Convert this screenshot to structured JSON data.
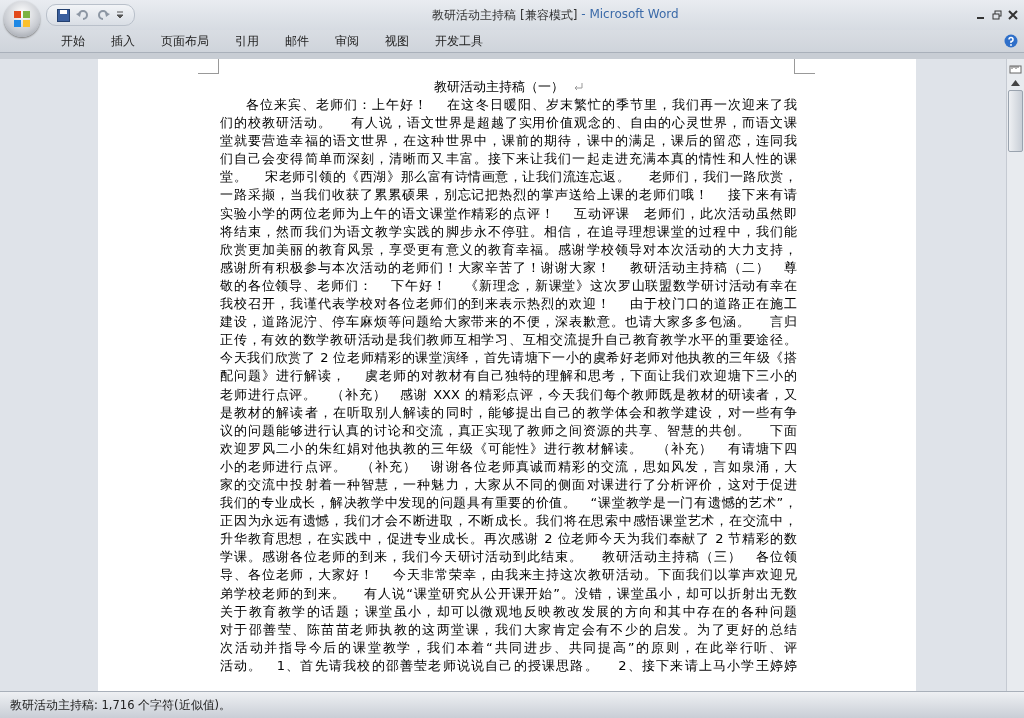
{
  "window": {
    "title": "教研活动主持稿 [兼容模式]",
    "app": " - Microsoft Word"
  },
  "ribbon_tabs": [
    "开始",
    "插入",
    "页面布局",
    "引用",
    "邮件",
    "审阅",
    "视图",
    "开发工具"
  ],
  "document": {
    "title": "教研活动主持稿（一）",
    "lines": [
      "各位来宾、老师们：上午好！　 在这冬日暖阳、岁末繁忙的季节里，我们再一次迎来了我",
      "们的校教研活动。　 有人说，语文世界是超越了实用价值观念的、自由的心灵世界，而语文课",
      "堂就要营造幸福的语文世界，在这种世界中，课前的期待，课中的满足，课后的留恋，连同我",
      "们自己会变得简单而深刻，清晰而又丰富。接下来让我们一起走进充满本真的情性和人性的课",
      "堂。　 宋老师引领的《西湖》那么富有诗情画意，让我们流连忘返。　 老师们，我们一路欣赏，",
      "一路采撷，当我们收获了累累硕果，别忘记把热烈的掌声送给上课的老师们哦！　 接下来有请",
      "实验小学的两位老师为上午的语文课堂作精彩的点评！　 互动评课　老师们，此次活动虽然即",
      "将结束，然而我们为语文教学实践的脚步永不停驻。相信，在追寻理想课堂的过程中，我们能",
      "欣赏更加美丽的教育风景，享受更有意义的教育幸福。感谢学校领导对本次活动的大力支持，",
      "感谢所有积极参与本次活动的老师们！大家辛苦了！谢谢大家！　 教研活动主持稿（二）　尊",
      "敬的各位领导、老师们：　 下午好！　 《新理念，新课堂》这次罗山联盟数学研讨活动有幸在",
      "我校召开，我谨代表学校对各位老师们的到来表示热烈的欢迎！　 由于校门口的道路正在施工",
      "建设，道路泥泞、停车麻烦等问题给大家带来的不便，深表歉意。也请大家多多包涵。　 言归",
      "正传，有效的数学教研活动是我们教师互相学习、互相交流提升自己教育教学水平的重要途径。",
      "今天我们欣赏了 2 位老师精彩的课堂演绎，首先请塘下一小的虞希好老师对他执教的三年级《搭",
      "配问题》进行解读，　 虞老师的对教材有自己独特的理解和思考，下面让我们欢迎塘下三小的",
      "老师进行点评。　（补充）　感谢 XXX 的精彩点评，今天我们每个教师既是教材的研读者，又",
      "是教材的解读者，在听取别人解读的同时，能够提出自己的教学体会和教学建设，对一些有争",
      "议的问题能够进行认真的讨论和交流，真正实现了教师之间资源的共享、智慧的共创。　 下面",
      "欢迎罗风二小的朱红娟对他执教的三年级《可能性》进行教材解读。　（补充）　有请塘下四",
      "小的老师进行点评。　（补充）　谢谢各位老师真诚而精彩的交流，思如风发，言如泉涌，大",
      "家的交流中投射着一种智慧，一种魅力，大家从不同的侧面对课进行了分析评价，这对于促进",
      "我们的专业成长，解决教学中发现的问题具有重要的价值。　“课堂教学是一门有遗憾的艺术”，",
      "正因为永远有遗憾，我们才会不断进取，不断成长。我们将在思索中感悟课堂艺术，在交流中，",
      "升华教育思想，在实践中，促进专业成长。再次感谢 2 位老师今天为我们奉献了 2 节精彩的数",
      "学课。感谢各位老师的到来，我们今天研讨活动到此结束。　 教研活动主持稿（三）　各位领",
      "导、各位老师，大家好！　 今天非常荣幸，由我来主持这次教研活动。下面我们以掌声欢迎兄",
      "弟学校老师的到来。　 有人说“课堂研究从公开课开始”。没错，课堂虽小，却可以折射出无数",
      "关于教育教学的话题；课堂虽小，却可以微观地反映教改发展的方向和其中存在的各种问题",
      "对于邵善莹、陈苗苗老师执教的这两堂课，我们大家肯定会有不少的启发。为了更好的总结",
      "次活动并指导今后的课堂教学，我们本着“共同进步、共同提高”的原则，在此举行听、评",
      "活动。　1、首先请我校的邵善莹老师说说自己的授课思路。　 2、接下来请上马小学王婷婷"
    ]
  },
  "status_bar": {
    "text": "教研活动主持稿: 1,716 个字符(近似值)。"
  }
}
